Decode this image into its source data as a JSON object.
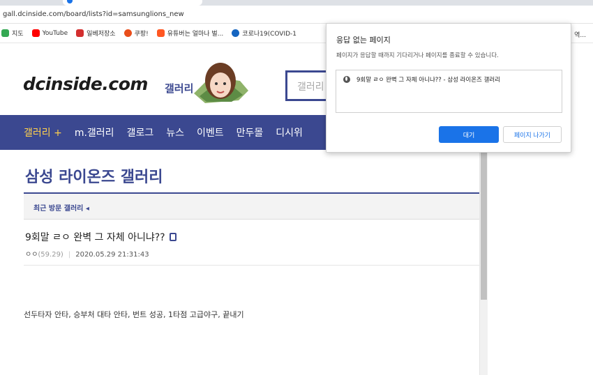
{
  "browser": {
    "url": "gall.dcinside.com/board/lists?id=samsunglions_new",
    "bookmarks": [
      {
        "label": "지도",
        "icon": "map-icon",
        "color": "#34a853"
      },
      {
        "label": "YouTube",
        "icon": "youtube-icon",
        "color": "#ff0000"
      },
      {
        "label": "일베저장소",
        "icon": "ilbe-icon",
        "color": "#d32f2f"
      },
      {
        "label": "쿠팡!",
        "icon": "coupang-icon",
        "color": "#e94e1b"
      },
      {
        "label": "유튜버는 얼마나 벌...",
        "icon": "playboard-icon",
        "color": "#ff5722"
      },
      {
        "label": "코로나19(COVID-1",
        "icon": "covid-icon",
        "color": "#1565c0"
      }
    ],
    "bookmarks_end": "역..."
  },
  "site": {
    "logo": "dcinside.com",
    "logo_suffix": "갤러리",
    "search_placeholder": "갤러리"
  },
  "nav": {
    "items": [
      "갤러리 +",
      "m.갤러리",
      "갤로그",
      "뉴스",
      "이벤트",
      "만두몰",
      "디시위"
    ]
  },
  "gallery": {
    "title": "삼성 라이온즈 갤러리",
    "recent_label": "최근 방문 갤러리 ◂"
  },
  "post": {
    "title": "9회말 ㄹㅇ 완벽 그 자체 아니냐??",
    "author": "ㅇㅇ",
    "ip": "(59.29)",
    "datetime": "2020.05.29 21:31:43",
    "body": "선두타자 안타, 승부처 대타 안타, 번트 성공, 1타점 고급야구, 끝내기"
  },
  "dialog": {
    "title": "응답 없는 페이지",
    "description": "페이지가 응답할 때까지 기다리거나 페이지를 종료할 수 있습니다.",
    "page_item": "9회말 ㄹㅇ 완벽 그 자체 아니냐?? - 삼성 라이온즈 갤러리",
    "wait_button": "대기",
    "exit_button": "페이지 나가기"
  },
  "colors": {
    "brand": "#3b4890",
    "nav_highlight": "#ffd04c",
    "primary_button": "#1a73e8"
  }
}
